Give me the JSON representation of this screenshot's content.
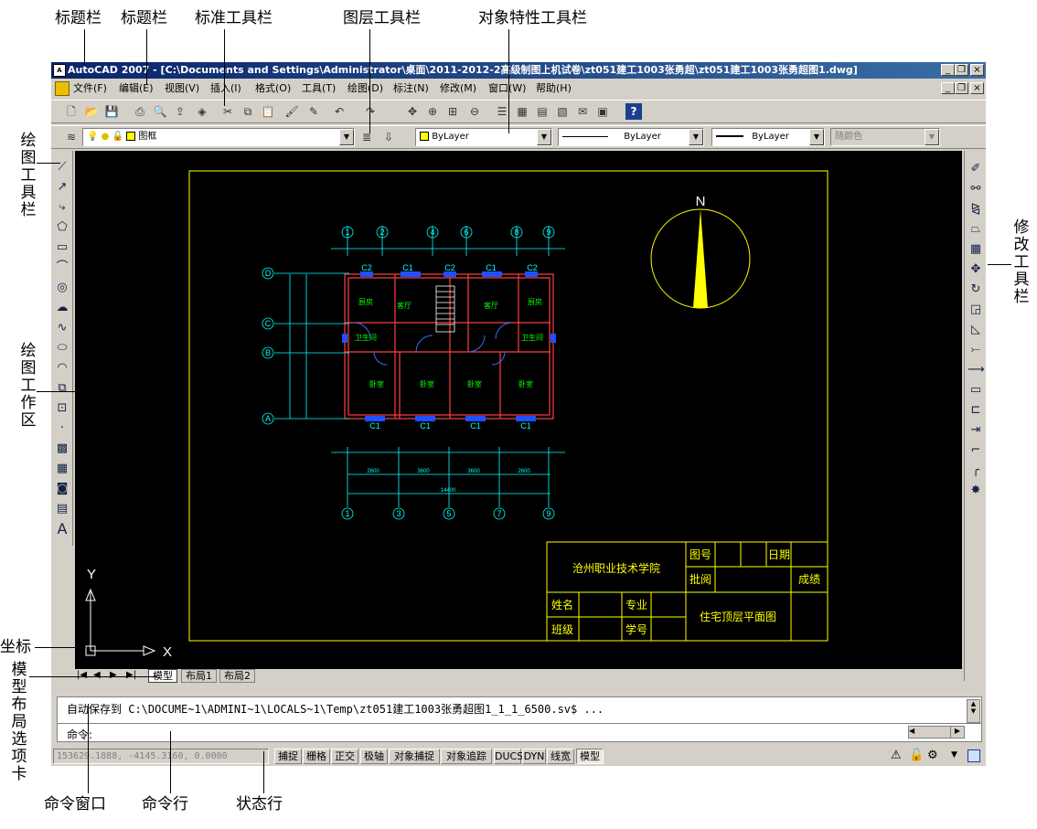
{
  "annotations": {
    "title1": "标题栏",
    "title2": "标题栏",
    "standard": "标准工具栏",
    "layer": "图层工具栏",
    "props": "对象特性工具栏",
    "draw_tb": "绘图工具栏",
    "draw_area": "绘图工作区",
    "modify_tb": "修改工具栏",
    "coord": "坐标",
    "tabs": "模型布局选项卡",
    "cmd_window": "命令窗口",
    "cmd_line": "命令行",
    "status": "状态行"
  },
  "title": "AutoCAD 2007 - [C:\\Documents and Settings\\Administrator\\桌面\\2011-2012-2高级制图上机试卷\\zt051建工1003张勇超\\zt051建工1003张勇超图1.dwg]",
  "menu": [
    "文件(F)",
    "编辑(E)",
    "视图(V)",
    "插入(I)",
    "格式(O)",
    "工具(T)",
    "绘图(D)",
    "标注(N)",
    "修改(M)",
    "窗口(W)",
    "帮助(H)"
  ],
  "layer_toolbar": {
    "current_layer": "图框"
  },
  "properties": {
    "color": "ByLayer",
    "linetype": "ByLayer",
    "lineweight": "ByLayer",
    "plotstyle": "随颜色"
  },
  "layout_tabs": [
    "模型",
    "布局1",
    "布局2"
  ],
  "command": {
    "history": "自动保存到 C:\\DOCUME~1\\ADMINI~1\\LOCALS~1\\Temp\\zt051建工1003张勇超图1_1_1_6500.sv$ ...",
    "prompt": "命令:"
  },
  "status": {
    "coords": "153629.1888, -4145.3160, 0.0000",
    "buttons": [
      "捕捉",
      "栅格",
      "正交",
      "极轴",
      "对象捕捉",
      "对象追踪",
      "DUCS",
      "DYN",
      "线宽",
      "模型"
    ]
  },
  "drawing": {
    "north": "N",
    "axes_top": [
      "1",
      "2",
      "4",
      "6",
      "8",
      "9"
    ],
    "axes_bottom": [
      "1",
      "3",
      "5",
      "7",
      "9"
    ],
    "axes_left": [
      "D",
      "C",
      "B",
      "A"
    ],
    "windows": [
      "C1",
      "C2"
    ],
    "rooms": [
      "厨房",
      "客厅",
      "卧室",
      "卫生间"
    ],
    "dims": [
      "2600",
      "3600",
      "14400"
    ],
    "titleblock": {
      "school": "沧州职业技术学院",
      "fig_no": "图号",
      "date": "日期",
      "review": "批阅",
      "score": "成绩",
      "name": "姓名",
      "major": "专业",
      "class": "班级",
      "student_id": "学号",
      "drawing_name": "住宅顶层平面图"
    }
  },
  "ucs": {
    "x": "X",
    "y": "Y"
  }
}
